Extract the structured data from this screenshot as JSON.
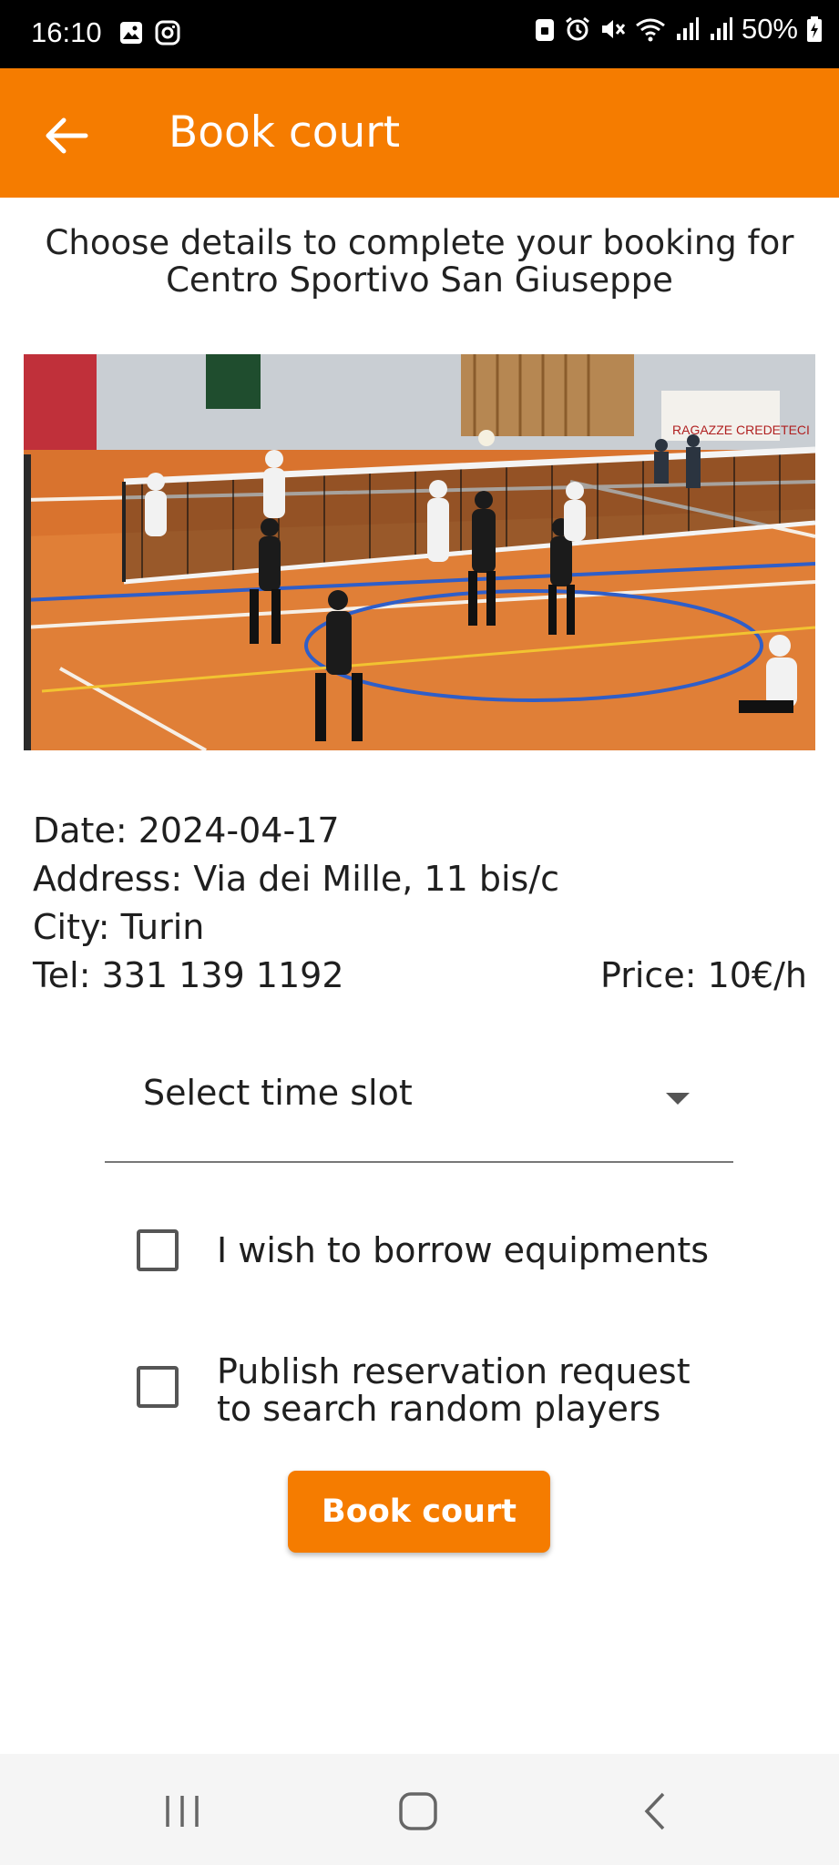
{
  "status_bar": {
    "time": "16:10",
    "battery": "50%",
    "icons": [
      "gallery-icon",
      "instagram-icon",
      "lock-icon",
      "alarm-icon",
      "mute-icon",
      "wifi-icon",
      "signal-icon",
      "signal-icon",
      "battery-icon"
    ]
  },
  "app_bar": {
    "title": "Book court",
    "back_icon": "arrow-left-icon"
  },
  "intro": {
    "line1": "Choose details to complete your booking for",
    "line2": "Centro Sportivo  San Giuseppe"
  },
  "photo": {
    "description_icon": "volleyball-court-photo"
  },
  "details": {
    "date": "Date: 2024-04-17",
    "address": "Address: Via dei Mille, 11 bis/c",
    "city": "City: Turin",
    "tel": "Tel: 331 139 1192",
    "price": "Price: 10€/h"
  },
  "time_slot": {
    "label": "Select time slot",
    "icon": "dropdown-arrow-icon"
  },
  "options": {
    "borrow": {
      "label": "I wish to borrow equipments",
      "checked": false
    },
    "publish": {
      "line1": "Publish reservation request",
      "line2": "to search random players",
      "checked": false
    }
  },
  "book_button": {
    "label": "Book court"
  },
  "nav_bar": {
    "icons": [
      "recent-apps-icon",
      "home-icon",
      "back-icon"
    ]
  },
  "colors": {
    "accent": "#f57c00",
    "status_bar": "#000000",
    "nav_bg": "#f5f5f5"
  }
}
